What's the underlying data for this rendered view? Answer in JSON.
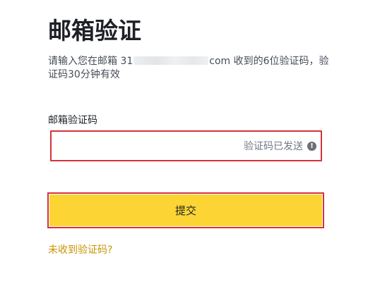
{
  "page": {
    "title": "邮箱验证"
  },
  "description": {
    "prefix": "请输入您在邮箱 31",
    "suffix": "com 收到的6位验证码，验",
    "line2": "证码30分钟有效"
  },
  "code_field": {
    "label": "邮箱验证码",
    "value": "",
    "placeholder": "",
    "status_text": "验证码已发送",
    "status_icon": "warning-icon",
    "error_border_color": "#d4333b"
  },
  "submit": {
    "label": "提交",
    "color": "#fcd535"
  },
  "resend": {
    "label": "未收到验证码?",
    "color": "#c99400"
  }
}
